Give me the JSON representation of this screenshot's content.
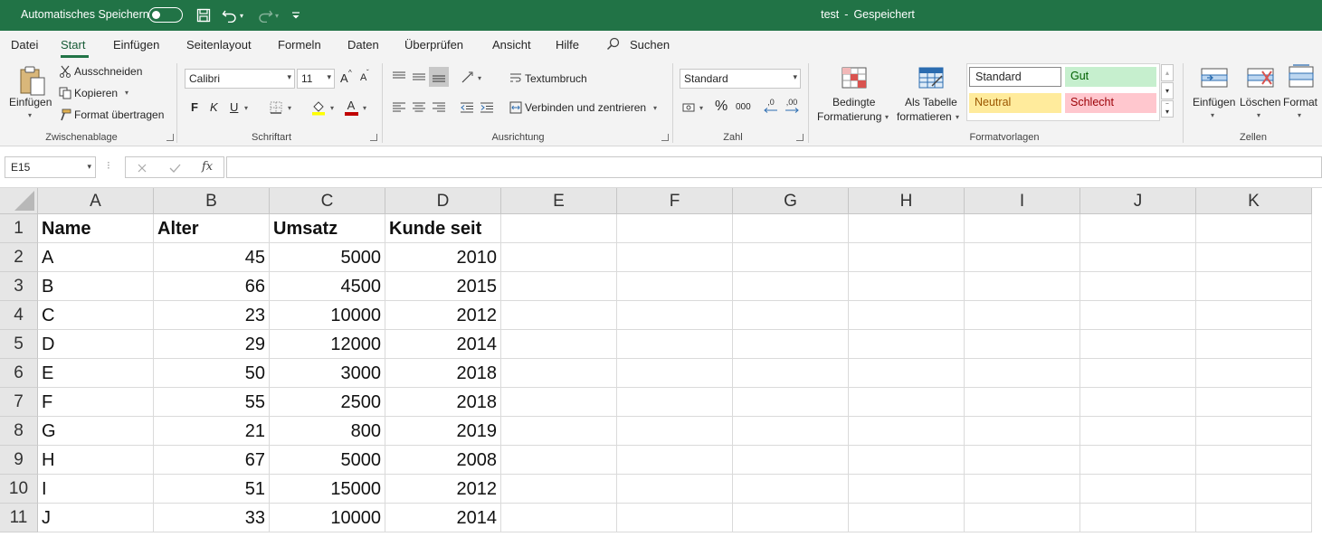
{
  "titlebar": {
    "autosave_label": "Automatisches Speichern",
    "doc_name": "test",
    "separator": "-",
    "save_status": "Gespeichert",
    "bg_color": "#217346"
  },
  "tabs": [
    "Datei",
    "Start",
    "Einfügen",
    "Seitenlayout",
    "Formeln",
    "Daten",
    "Überprüfen",
    "Ansicht",
    "Hilfe"
  ],
  "search_label": "Suchen",
  "ribbon": {
    "clipboard": {
      "paste": "Einfügen",
      "cut": "Ausschneiden",
      "copy": "Kopieren",
      "format_painter": "Format übertragen",
      "group": "Zwischenablage"
    },
    "font": {
      "font_name": "Calibri",
      "font_size": "11",
      "bold": "F",
      "italic": "K",
      "underline": "U",
      "grow": "A",
      "shrink": "A",
      "font_color_letter": "A",
      "group": "Schriftart"
    },
    "alignment": {
      "wrap": "Textumbruch",
      "merge": "Verbinden und zentrieren",
      "group": "Ausrichtung"
    },
    "number": {
      "format": "Standard",
      "percent": "%",
      "thousands": "000",
      "inc_decimal": ",0",
      "dec_decimal": ",00",
      "group": "Zahl"
    },
    "styles": {
      "conditional_line1": "Bedingte",
      "conditional_line2": "Formatierung",
      "table_line1": "Als Tabelle",
      "table_line2": "formatieren",
      "standard": "Standard",
      "good": "Gut",
      "neutral": "Neutral",
      "bad": "Schlecht",
      "group": "Formatvorlagen",
      "colors": {
        "good_bg": "#c6efce",
        "good_fg": "#006100",
        "neutral_bg": "#ffeb9c",
        "neutral_fg": "#9c5700",
        "bad_bg": "#ffc7ce",
        "bad_fg": "#9c0006"
      }
    },
    "cells": {
      "insert": "Einfügen",
      "delete": "Löschen",
      "format": "Format",
      "group": "Zellen"
    }
  },
  "formula_bar": {
    "name_box": "E15",
    "fx": "fx",
    "value": ""
  },
  "sheet": {
    "columns": [
      "A",
      "B",
      "C",
      "D",
      "E",
      "F",
      "G",
      "H",
      "I",
      "J",
      "K"
    ],
    "rows": [
      {
        "n": "1",
        "cells": [
          "Name",
          "Alter",
          "Umsatz",
          "Kunde seit"
        ]
      },
      {
        "n": "2",
        "cells": [
          "A",
          "45",
          "5000",
          "2010"
        ]
      },
      {
        "n": "3",
        "cells": [
          "B",
          "66",
          "4500",
          "2015"
        ]
      },
      {
        "n": "4",
        "cells": [
          "C",
          "23",
          "10000",
          "2012"
        ]
      },
      {
        "n": "5",
        "cells": [
          "D",
          "29",
          "12000",
          "2014"
        ]
      },
      {
        "n": "6",
        "cells": [
          "E",
          "50",
          "3000",
          "2018"
        ]
      },
      {
        "n": "7",
        "cells": [
          "F",
          "55",
          "2500",
          "2018"
        ]
      },
      {
        "n": "8",
        "cells": [
          "G",
          "21",
          "800",
          "2019"
        ]
      },
      {
        "n": "9",
        "cells": [
          "H",
          "67",
          "5000",
          "2008"
        ]
      },
      {
        "n": "10",
        "cells": [
          "I",
          "51",
          "15000",
          "2012"
        ]
      },
      {
        "n": "11",
        "cells": [
          "J",
          "33",
          "10000",
          "2014"
        ]
      }
    ]
  }
}
